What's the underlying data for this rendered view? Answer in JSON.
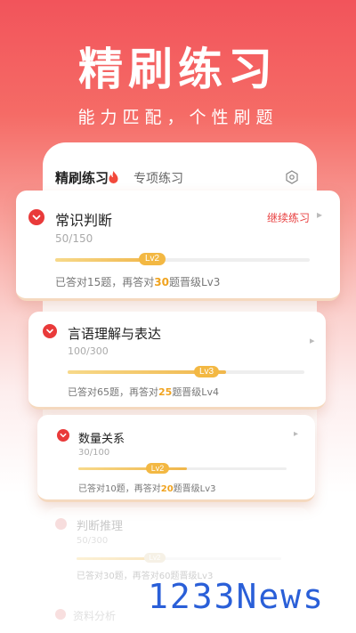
{
  "hero": {
    "title": "精刷练习",
    "subtitle": "能力匹配，个性刷题"
  },
  "tabs": {
    "active": "精刷练习",
    "other": "专项练习"
  },
  "cards": [
    {
      "name": "常识判断",
      "count": "50/150",
      "progress": 0.4,
      "level": "Lv2",
      "note_prefix": "已答对15题，再答对",
      "note_highlight": "30",
      "note_suffix": "题晋级Lv3",
      "action": "继续练习"
    },
    {
      "name": "言语理解与表达",
      "count": "100/300",
      "progress": 0.67,
      "level": "Lv3",
      "note_prefix": "已答对65题，再答对",
      "note_highlight": "25",
      "note_suffix": "题晋级Lv4"
    },
    {
      "name": "数量关系",
      "count": "30/100",
      "progress": 0.52,
      "level": "Lv2",
      "note_prefix": "已答对10题，再答对",
      "note_highlight": "20",
      "note_suffix": "题晋级Lv3"
    },
    {
      "name": "判断推理",
      "count": "50/300",
      "progress": 0.4,
      "level": "Lv2",
      "note": "已答对30题，再答对60题晋级Lv3"
    },
    {
      "name": "资料分析"
    }
  ],
  "watermark": "1233News",
  "colors": {
    "accent": "#e93a3a",
    "highlight": "#f0a31f",
    "level_badge": "#f3b843",
    "watermark": "#2a5fd8"
  }
}
